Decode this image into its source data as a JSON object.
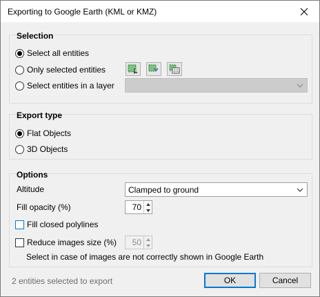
{
  "window": {
    "title": "Exporting to Google Earth (KML or KMZ)"
  },
  "selection": {
    "title": "Selection",
    "options": [
      "Select all entities",
      "Only selected entities",
      "Select entities in a layer"
    ],
    "layer_value": ""
  },
  "export_type": {
    "title": "Export type",
    "options": [
      "Flat Objects",
      "3D Objects"
    ]
  },
  "options": {
    "title": "Options",
    "altitude_label": "Altitude",
    "altitude_value": "Clamped to ground",
    "fill_opacity_label": "Fill opacity (%)",
    "fill_opacity_value": "70",
    "fill_closed_label": "Fill closed polylines",
    "reduce_label": "Reduce images size (%)",
    "reduce_value": "50",
    "reduce_hint": "Select in case of images are not correctly shown in Google Earth"
  },
  "footer": {
    "status": "2 entities selected to export",
    "ok_label": "OK",
    "cancel_label": "Cancel"
  }
}
